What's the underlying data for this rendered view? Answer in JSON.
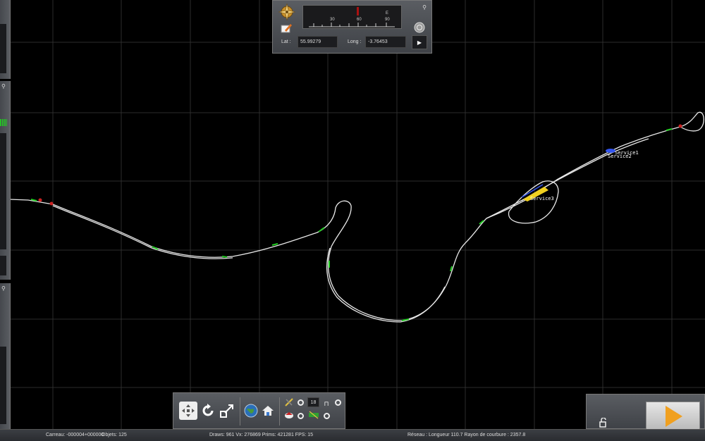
{
  "compass": {
    "heading_ticks": [
      "30",
      "60",
      "90"
    ],
    "heading_letter": "E",
    "lat_label": "Lat :",
    "lat_value": "55.99279",
    "long_label": "Long :",
    "long_value": "-3.76453"
  },
  "map": {
    "labels": [
      "Service1",
      "Service2",
      "Service3"
    ]
  },
  "toolbar": {
    "speed_value": "18"
  },
  "status": {
    "tile": "Carreau: -000004+000000",
    "objects": "Objets: 125",
    "stats": "Draws: 961 Vx: 276869 Prims: 421281 FPS: 15",
    "network": "Réseau : Longueur 110.7 Rayon de courbure : 2357.8"
  },
  "colors": {
    "track": "#e8e8e8",
    "marker": "#22cc22",
    "signal": "#cc2222",
    "panel": "#4c4f54",
    "play": "#f0a020"
  }
}
